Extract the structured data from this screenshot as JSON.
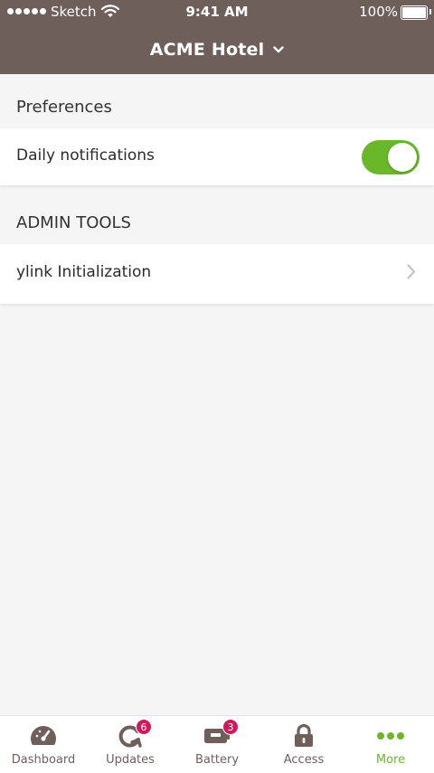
{
  "status_bar": {
    "carrier": "Sketch",
    "time": "9:41 AM",
    "battery": "100%"
  },
  "header": {
    "title": "ACME Hotel",
    "background_color": "#6f5f5b"
  },
  "preferences": {
    "title": "Preferences",
    "daily_notifications": {
      "label": "Daily notifications",
      "enabled": true
    }
  },
  "admin_tools": {
    "title": "ADMIN TOOLS",
    "items": [
      {
        "label": "ylink Initialization"
      }
    ]
  },
  "tabbar": {
    "active_tab": "More",
    "accent_color": "#6ab82a",
    "badge_color": "#d0185a",
    "tabs": [
      {
        "label": "Dashboard",
        "icon": "gauge-icon"
      },
      {
        "label": "Updates",
        "icon": "refresh-icon",
        "badge": "6"
      },
      {
        "label": "Battery",
        "icon": "battery-icon",
        "badge": "3"
      },
      {
        "label": "Access",
        "icon": "lock-icon"
      },
      {
        "label": "More",
        "icon": "more-dots-icon"
      }
    ]
  }
}
